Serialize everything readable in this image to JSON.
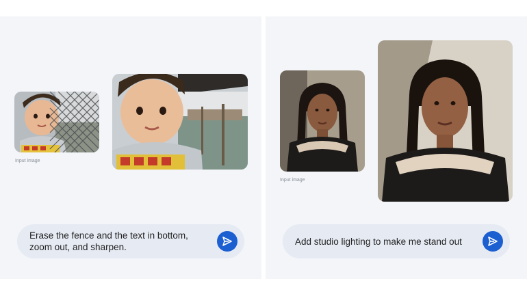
{
  "left": {
    "input_caption": "Input image",
    "prompt": "Erase the fence and the text in bottom, zoom out, and sharpen.",
    "send_icon": "send-icon"
  },
  "right": {
    "input_caption": "Input image",
    "prompt": "Add studio lighting to make me stand out",
    "send_icon": "send-icon"
  },
  "colors": {
    "panel_bg": "#f3f5f9",
    "prompt_bg": "#e6eaf3",
    "send_button": "#1b5fd1"
  }
}
